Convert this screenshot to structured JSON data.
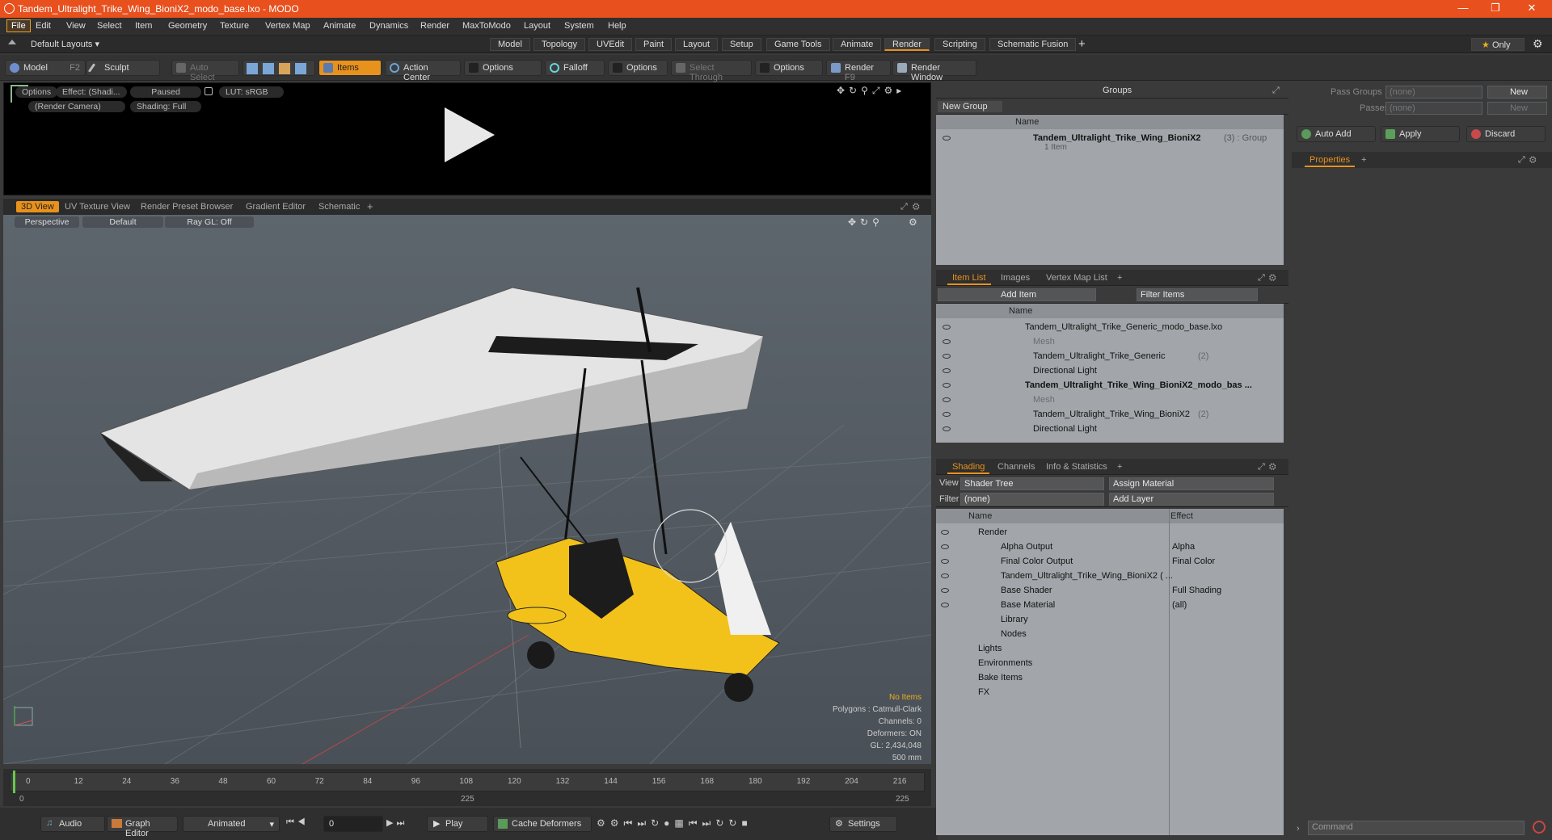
{
  "window": {
    "title": "Tandem_Ultralight_Trike_Wing_BioniX2_modo_base.lxo - MODO"
  },
  "menu": [
    "File",
    "Edit",
    "View",
    "Select",
    "Item",
    "Geometry",
    "Texture",
    "Vertex Map",
    "Animate",
    "Dynamics",
    "Render",
    "MaxToModo",
    "Layout",
    "System",
    "Help"
  ],
  "layout": {
    "selector": "Default Layouts",
    "tabs": [
      "Model",
      "Topology",
      "UVEdit",
      "Paint",
      "Layout",
      "Setup",
      "Game Tools",
      "Animate",
      "Render",
      "Scripting",
      "Schematic Fusion"
    ],
    "active": "Render",
    "only": "Only"
  },
  "toolbar": {
    "model": "Model",
    "model_key": "F2",
    "sculpt": "Sculpt",
    "auto_select": "Auto Select",
    "items": "Items",
    "action_center": "Action Center",
    "options1": "Options",
    "falloff": "Falloff",
    "options2": "Options",
    "select_through": "Select Through",
    "options3": "Options",
    "render": "Render",
    "render_key": "F9",
    "render_window": "Render Window"
  },
  "preview": {
    "options": "Options",
    "effect": "Effect: (Shadi...",
    "paused": "Paused",
    "lut": "LUT: sRGB",
    "camera": "(Render Camera)",
    "shading": "Shading: Full"
  },
  "viewtabs": [
    "3D View",
    "UV Texture View",
    "Render Preset Browser",
    "Gradient Editor",
    "Schematic"
  ],
  "viewport": {
    "perspective": "Perspective",
    "default": "Default",
    "raygl": "Ray GL: Off",
    "info": {
      "no_items": "No Items",
      "polygons": "Polygons : Catmull-Clark",
      "channels": "Channels: 0",
      "deformers": "Deformers: ON",
      "gl": "GL: 2,434,048",
      "scale": "500 mm"
    }
  },
  "timeline": {
    "ticks": [
      "0",
      "12",
      "24",
      "36",
      "48",
      "60",
      "72",
      "84",
      "96",
      "108",
      "120",
      "132",
      "144",
      "156",
      "168",
      "180",
      "192",
      "204",
      "216"
    ],
    "start": "0",
    "mid": "225",
    "end": "225"
  },
  "bottombar": {
    "audio": "Audio",
    "graph_editor": "Graph Editor",
    "animated": "Animated",
    "frame": "0",
    "play": "Play",
    "cache_deformers": "Cache Deformers",
    "settings": "Settings"
  },
  "groups": {
    "title": "Groups",
    "new_group": "New Group",
    "col_name": "Name",
    "item_name": "Tandem_Ultralight_Trike_Wing_BioniX2",
    "item_count": "(3)",
    "item_type": ": Group",
    "item_sub": "1 Item"
  },
  "itemlist": {
    "tabs": [
      "Item List",
      "Images",
      "Vertex Map List"
    ],
    "add_item": "Add Item",
    "filter": "Filter Items",
    "col_name": "Name",
    "rows": [
      {
        "label": "Tandem_Ultralight_Trike_Generic_modo_base.lxo",
        "indent": 0,
        "bold": false,
        "dim": false,
        "suffix": ""
      },
      {
        "label": "Mesh",
        "indent": 1,
        "bold": false,
        "dim": true,
        "suffix": ""
      },
      {
        "label": "Tandem_Ultralight_Trike_Generic",
        "indent": 1,
        "bold": false,
        "dim": false,
        "suffix": "(2)"
      },
      {
        "label": "Directional Light",
        "indent": 1,
        "bold": false,
        "dim": false,
        "suffix": ""
      },
      {
        "label": "Tandem_Ultralight_Trike_Wing_BioniX2_modo_bas ...",
        "indent": 0,
        "bold": true,
        "dim": false,
        "suffix": ""
      },
      {
        "label": "Mesh",
        "indent": 1,
        "bold": false,
        "dim": true,
        "suffix": ""
      },
      {
        "label": "Tandem_Ultralight_Trike_Wing_BioniX2",
        "indent": 1,
        "bold": false,
        "dim": false,
        "suffix": "(2)"
      },
      {
        "label": "Directional Light",
        "indent": 1,
        "bold": false,
        "dim": false,
        "suffix": ""
      }
    ]
  },
  "shading": {
    "tabs": [
      "Shading",
      "Channels",
      "Info & Statistics"
    ],
    "view_label": "View",
    "view_value": "Shader Tree",
    "assign_material": "Assign Material",
    "filter_label": "Filter",
    "filter_value": "(none)",
    "add_layer": "Add Layer",
    "col_name": "Name",
    "col_effect": "Effect",
    "rows": [
      {
        "label": "Render",
        "effect": "",
        "indent": 0
      },
      {
        "label": "Alpha Output",
        "effect": "Alpha",
        "indent": 1
      },
      {
        "label": "Final Color Output",
        "effect": "Final Color",
        "indent": 1
      },
      {
        "label": "Tandem_Ultralight_Trike_Wing_BioniX2 ( ...",
        "effect": "",
        "indent": 1
      },
      {
        "label": "Base Shader",
        "effect": "Full Shading",
        "indent": 1
      },
      {
        "label": "Base Material",
        "effect": "(all)",
        "indent": 1
      },
      {
        "label": "Library",
        "effect": "",
        "indent": 1
      },
      {
        "label": "Nodes",
        "effect": "",
        "indent": 1
      },
      {
        "label": "Lights",
        "effect": "",
        "indent": 0
      },
      {
        "label": "Environments",
        "effect": "",
        "indent": 0
      },
      {
        "label": "Bake Items",
        "effect": "",
        "indent": 0
      },
      {
        "label": "FX",
        "effect": "",
        "indent": 0
      }
    ]
  },
  "passes": {
    "pass_groups": "Pass Groups",
    "pass_groups_value": "(none)",
    "passes": "Passes",
    "passes_value": "(none)",
    "new1": "New",
    "new2": "New",
    "auto_add": "Auto Add",
    "apply": "Apply",
    "discard": "Discard",
    "properties": "Properties",
    "command": "Command"
  },
  "colors": {
    "accent": "#e8921e",
    "title_bar": "#e8501e"
  }
}
